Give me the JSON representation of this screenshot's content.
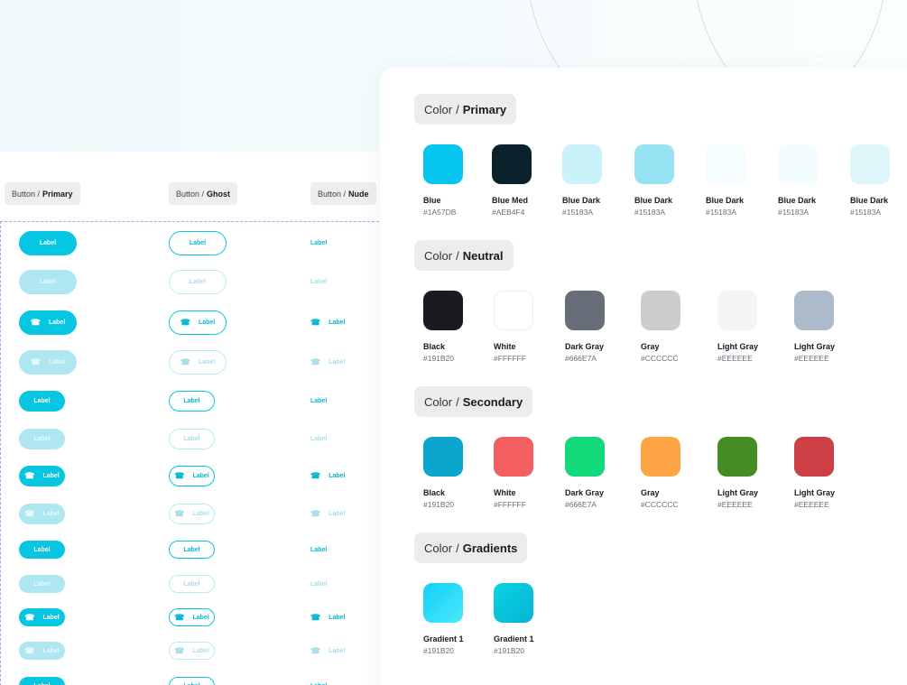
{
  "button_sheet": {
    "headers": [
      {
        "prefix": "Button /",
        "bold": "Primary"
      },
      {
        "prefix": "Button /",
        "bold": "Ghost"
      },
      {
        "prefix": "Button /",
        "bold": "Nude"
      }
    ],
    "button_label": "Label",
    "icon": "phone-icon"
  },
  "color_panel": {
    "sections": [
      {
        "prefix": "Color",
        "bold": "Primary",
        "swatches": [
          {
            "name": "Blue",
            "hex": "#1A57DB",
            "color": "#06c5ee"
          },
          {
            "name": "Blue Med",
            "hex": "#AEB4F4",
            "color": "#0b222c"
          },
          {
            "name": "Blue Dark",
            "hex": "#15183A",
            "color": "#c9f2fb"
          },
          {
            "name": "Blue Dark",
            "hex": "#15183A",
            "color": "#97e3f3"
          },
          {
            "name": "Blue Dark",
            "hex": "#15183A",
            "color": "#f5fdff"
          },
          {
            "name": "Blue Dark",
            "hex": "#15183A",
            "color": "#f3fcfe"
          },
          {
            "name": "Blue Dark",
            "hex": "#15183A",
            "color": "#def6f9"
          }
        ]
      },
      {
        "prefix": "Color",
        "bold": "Neutral",
        "swatches": [
          {
            "name": "Black",
            "hex": "#191B20",
            "color": "#191b20"
          },
          {
            "name": "White",
            "hex": "#FFFFFF",
            "color": "#ffffff"
          },
          {
            "name": "Dark Gray",
            "hex": "#666E7A",
            "color": "#666e7a"
          },
          {
            "name": "Gray",
            "hex": "#CCCCCC",
            "color": "#cccccc"
          },
          {
            "name": "Light Gray",
            "hex": "#EEEEEE",
            "color": "#f4f4f4"
          },
          {
            "name": "Light Gray",
            "hex": "#EEEEEE",
            "color": "#adbacb"
          }
        ]
      },
      {
        "prefix": "Color",
        "bold": "Secondary",
        "swatches": [
          {
            "name": "Black",
            "hex": "#191B20",
            "color": "#0ba6ce"
          },
          {
            "name": "White",
            "hex": "#FFFFFF",
            "color": "#f35f60"
          },
          {
            "name": "Dark Gray",
            "hex": "#666E7A",
            "color": "#12d97a"
          },
          {
            "name": "Gray",
            "hex": "#CCCCCC",
            "color": "#fda544"
          },
          {
            "name": "Light Gray",
            "hex": "#EEEEEE",
            "color": "#438d22"
          },
          {
            "name": "Light Gray",
            "hex": "#EEEEEE",
            "color": "#cc4045"
          }
        ]
      },
      {
        "prefix": "Color",
        "bold": "Gradients",
        "swatches": [
          {
            "name": "Gradient 1",
            "hex": "#191B20",
            "color": "linear-gradient(135deg,#0fd0fb 0%,#4de8f6 100%)"
          },
          {
            "name": "Gradient 1",
            "hex": "#191B20",
            "color": "linear-gradient(135deg,#0ad3e0 0%,#06b4d6 100%)"
          }
        ]
      }
    ]
  }
}
